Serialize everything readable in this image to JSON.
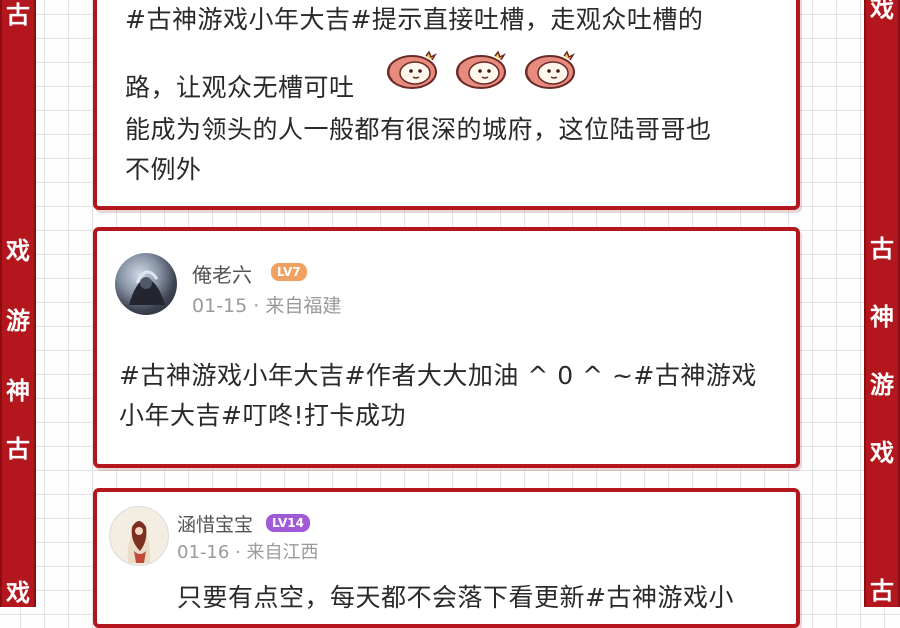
{
  "side_banner": {
    "left_chars": [
      "古",
      "戏",
      "游",
      "神",
      "古",
      "戏"
    ],
    "right_chars": [
      "戏",
      "古",
      "神",
      "游",
      "戏",
      "古"
    ]
  },
  "posts": [
    {
      "lines": [
        "#古神游戏小年大吉#提示直接吐槽，走观众吐槽的",
        "路，让观众无槽可吐",
        "能成为领头的人一般都有很深的城府，这位陆哥哥也",
        "不例外"
      ],
      "stickers": [
        "monkey-sticker",
        "monkey-sticker",
        "monkey-sticker"
      ]
    },
    {
      "username": "俺老六",
      "level": "LV7",
      "level_color": "#f0a060",
      "date": "01-15",
      "location": "来自福建",
      "lines": [
        "#古神游戏小年大吉#作者大大加油 ^ 0 ^ ~#古神游戏",
        "小年大吉#叮咚!打卡成功"
      ]
    },
    {
      "username": "涵惜宝宝",
      "level": "LV14",
      "level_color": "#a05ad8",
      "date": "01-16",
      "location": "来自江西",
      "lines": [
        "只要有点空，每天都不会落下看更新#古神游戏小"
      ]
    }
  ],
  "meta_separator": " · "
}
